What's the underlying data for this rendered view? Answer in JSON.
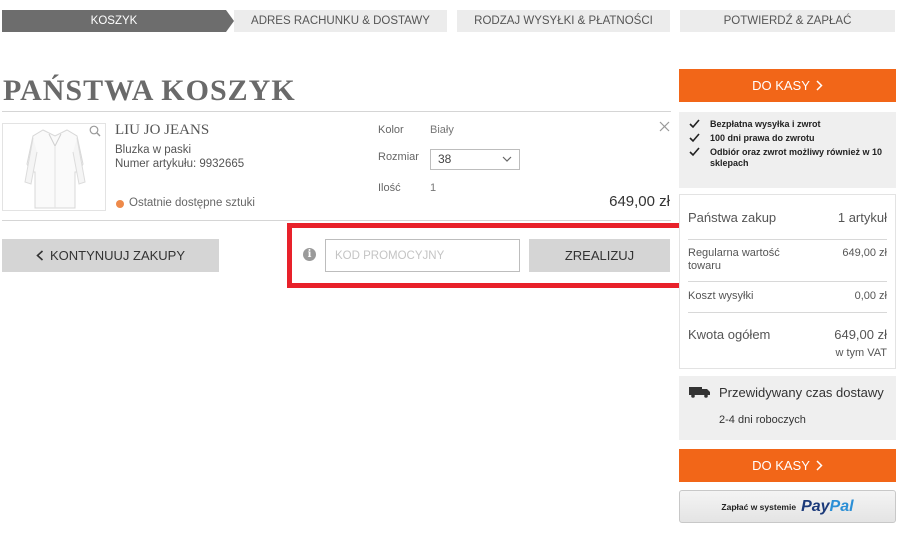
{
  "steps": [
    "KOSZYK",
    "ADRES RACHUNKU & DOSTAWY",
    "RODZAJ WYSYŁKI & PŁATNOŚCI",
    "POTWIERDŹ & ZAPŁAĆ"
  ],
  "page_title": "PAŃSTWA KOSZYK",
  "item": {
    "brand": "LIU JO JEANS",
    "description": "Bluzka w paski",
    "article_number": "Numer artykułu: 9932665",
    "availability": "Ostatnie dostępne sztuki",
    "color_label": "Kolor",
    "color_value": "Biały",
    "size_label": "Rozmiar",
    "size_value": "38",
    "qty_label": "Ilość",
    "qty_value": "1",
    "price": "649,00 zł"
  },
  "continue_label": "KONTYNUUJ ZAKUPY",
  "promo": {
    "placeholder": "KOD PROMOCYJNY",
    "redeem_label": "ZREALIZUJ"
  },
  "checkout_label": "DO KASY",
  "benefits": [
    "Bezpłatna wysyłka i zwrot",
    "100 dni prawa do zwrotu",
    "Odbiór oraz zwrot możliwy również w 10 sklepach"
  ],
  "summary": {
    "title": "Państwa zakup",
    "count": "1 artykuł",
    "regular_label": "Regularna wartość towaru",
    "regular_value": "649,00 zł",
    "shipping_label": "Koszt wysyłki",
    "shipping_value": "0,00 zł",
    "total_label": "Kwota ogółem",
    "total_value": "649,00 zł",
    "vat_note": "w tym VAT"
  },
  "delivery": {
    "title": "Przewidywany czas dostawy",
    "time": "2-4 dni roboczych"
  },
  "paypal": {
    "prefix": "Zapłać w systemie",
    "logo_pay": "Pay",
    "logo_pal": "Pal"
  },
  "colors": {
    "accent_orange": "#f26618",
    "highlight_red": "#e8212a",
    "active_step": "#6d6d6d"
  }
}
